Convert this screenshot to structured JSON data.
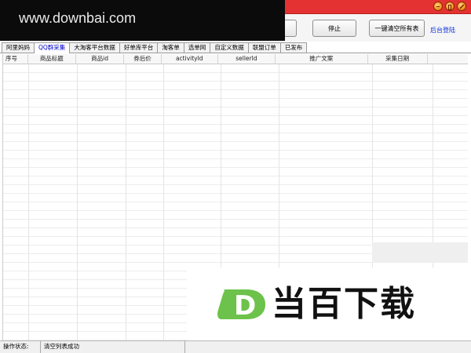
{
  "watermark": "www.downbai.com",
  "toolbar": {
    "stop_label": "停止",
    "clear_label": "一键清空所有表",
    "admin_login_label": "后台登陆"
  },
  "tabs": [
    {
      "label": "阿里妈妈",
      "active": false
    },
    {
      "label": "QQ群采集",
      "active": true
    },
    {
      "label": "大淘客平台数据",
      "active": false
    },
    {
      "label": "好单库平台",
      "active": false
    },
    {
      "label": "淘客单",
      "active": false
    },
    {
      "label": "选单网",
      "active": false
    },
    {
      "label": "自定义数据",
      "active": false
    },
    {
      "label": "联盟订单",
      "active": false
    },
    {
      "label": "已发布",
      "active": false
    }
  ],
  "table": {
    "columns": [
      "序号",
      "商品标题",
      "商品id",
      "券后价",
      "activityId",
      "sellerId",
      "推广文案",
      "采集日期"
    ]
  },
  "logo": {
    "glyph": "D",
    "text": "当百下载"
  },
  "statusbar": {
    "label": "操作状态:",
    "message": "清空列表成功"
  },
  "colors": {
    "titlebar": "#e43232",
    "link": "#0a2fd6",
    "logo_green": "#6cc24a",
    "active_tab_text": "#0000cc"
  }
}
